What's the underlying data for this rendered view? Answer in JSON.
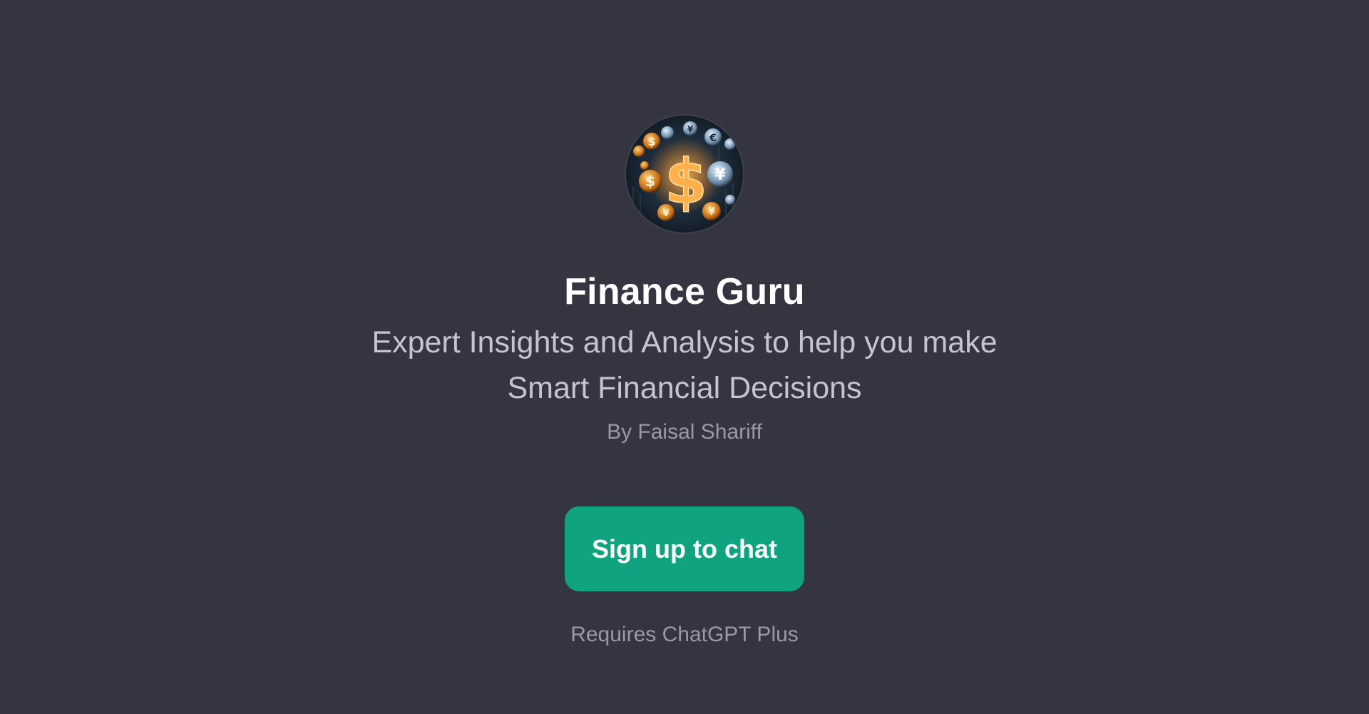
{
  "gpt": {
    "avatar_icon": "dollar-coins-logo",
    "title": "Finance Guru",
    "description": "Expert Insights and Analysis to help you make Smart Financial Decisions",
    "author": "By Faisal Shariff"
  },
  "cta": {
    "signup_label": "Sign up to chat",
    "requirement": "Requires ChatGPT Plus"
  },
  "colors": {
    "background": "#343541",
    "accent": "#10a37f",
    "title": "#ffffff",
    "subtitle": "#c5c5d2",
    "muted": "#9a9aa6"
  }
}
